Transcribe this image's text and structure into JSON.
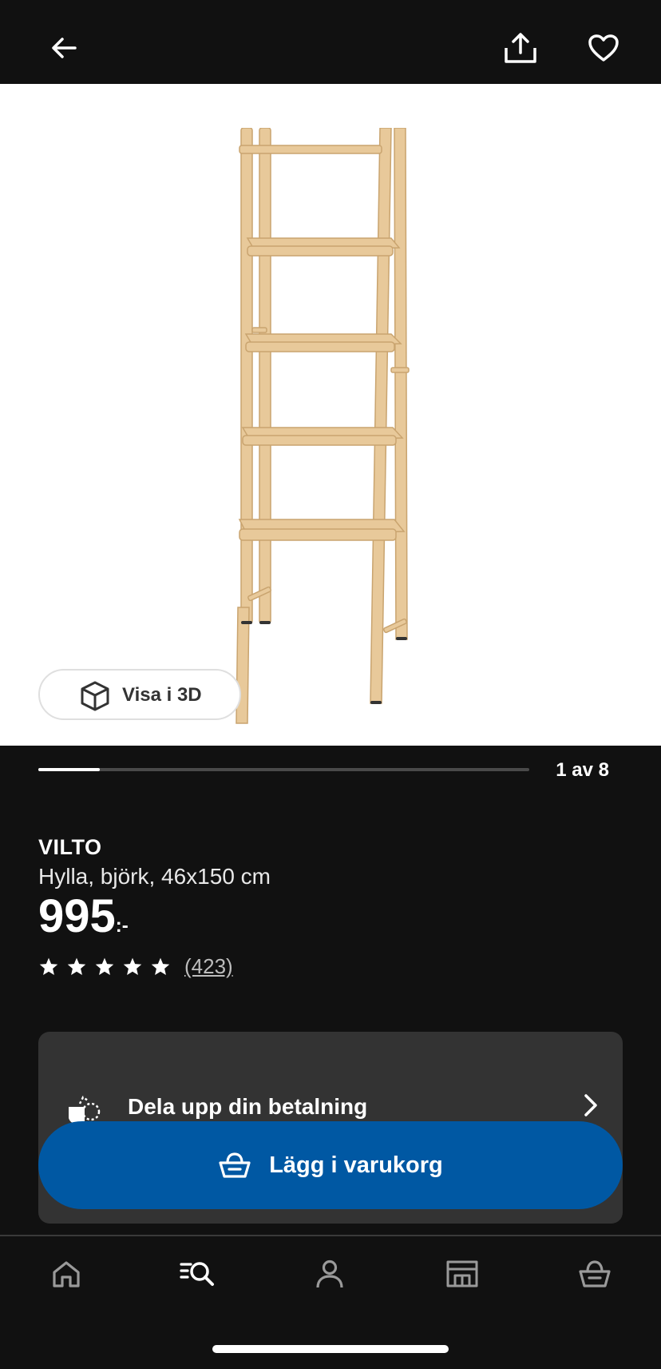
{
  "header": {
    "back_icon": "arrow-left-icon",
    "share_icon": "share-upload-icon",
    "favorite_icon": "heart-outline-icon"
  },
  "gallery": {
    "view_3d_label": "Visa i 3D",
    "counter": "1 av 8",
    "current_index": 1,
    "total_images": 8,
    "image": "ladder-shelf-product-photo"
  },
  "product": {
    "name": "VILTO",
    "description": "Hylla, björk, 46x150 cm",
    "price_integer": "995",
    "price_suffix": ":-",
    "rating_stars": 5,
    "review_count": "(423)"
  },
  "payment": {
    "label": "Dela upp din betalning",
    "icon": "payment-split-icon"
  },
  "actions": {
    "add_to_cart_label": "Lägg i varukorg",
    "add_to_cart_icon": "basket-icon"
  },
  "bottom_nav": {
    "items": [
      {
        "name": "home",
        "icon": "home-icon"
      },
      {
        "name": "search",
        "icon": "search-icon"
      },
      {
        "name": "profile",
        "icon": "person-icon"
      },
      {
        "name": "stores",
        "icon": "store-icon"
      },
      {
        "name": "cart",
        "icon": "basket-icon"
      }
    ]
  },
  "colors": {
    "background": "#111111",
    "accent": "#0058a3",
    "card": "#333333",
    "wood": "#e8c99a"
  }
}
